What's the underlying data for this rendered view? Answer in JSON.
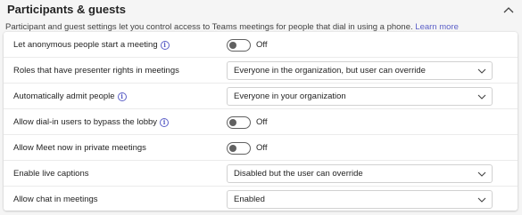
{
  "section": {
    "title": "Participants & guests",
    "description": "Participant and guest settings let you control access to Teams meetings for people that dial in using a phone.",
    "learn_more": "Learn more",
    "collapse_icon": "chevron-up-icon"
  },
  "settings": [
    {
      "label": "Let anonymous people start a meeting",
      "info": true,
      "type": "toggle",
      "value": "Off"
    },
    {
      "label": "Roles that have presenter rights in meetings",
      "info": false,
      "type": "dropdown",
      "value": "Everyone in the organization, but user can override"
    },
    {
      "label": "Automatically admit people",
      "info": true,
      "type": "dropdown",
      "value": "Everyone in your organization"
    },
    {
      "label": "Allow dial-in users to bypass the lobby",
      "info": true,
      "type": "toggle",
      "value": "Off"
    },
    {
      "label": "Allow Meet now in private meetings",
      "info": false,
      "type": "toggle",
      "value": "Off"
    },
    {
      "label": "Enable live captions",
      "info": false,
      "type": "dropdown",
      "value": "Disabled but the user can override"
    },
    {
      "label": "Allow chat in meetings",
      "info": false,
      "type": "dropdown",
      "value": "Enabled"
    }
  ],
  "colors": {
    "accent": "#5b5fc7",
    "toggle_off": "#616161",
    "background": "#f5f5f5",
    "card": "#ffffff"
  }
}
